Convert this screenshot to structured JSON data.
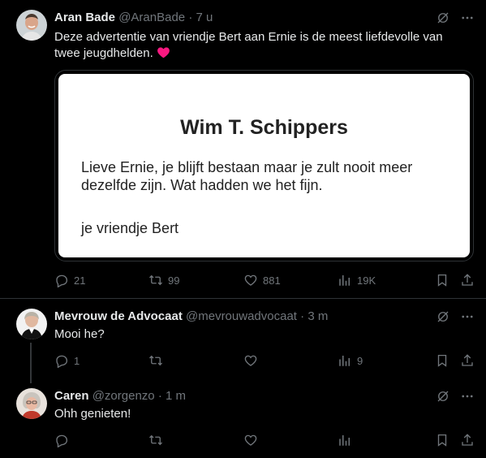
{
  "tweets": [
    {
      "name": "Aran Bade",
      "handle": "@AranBade",
      "dot": "·",
      "time": "7 u",
      "text": "Deze advertentie van vriendje Bert aan Ernie is de meest liefdevolle van twee jeugdhelden.",
      "emoji": "❤️",
      "card": {
        "title": "Wim T. Schippers",
        "message": "Lieve Ernie, je blijft bestaan maar je zult nooit meer dezelfde zijn. Wat hadden we het fijn.",
        "signature": "je vriendje Bert"
      },
      "replies": "21",
      "reposts": "99",
      "likes": "881",
      "views": "19K"
    },
    {
      "name": "Mevrouw de Advocaat",
      "handle": "@mevrouwadvocaat",
      "dot": "·",
      "time": "3 m",
      "text": "Mooi he?",
      "replies": "1",
      "reposts": "",
      "likes": "",
      "views": "9"
    },
    {
      "name": "Caren",
      "handle": "@zorgenzo",
      "dot": "·",
      "time": "1 m",
      "text": "Ohh genieten!",
      "replies": "",
      "reposts": "",
      "likes": "",
      "views": ""
    }
  ],
  "icons": {
    "grok": "grok-icon",
    "more": "more-icon",
    "reply": "reply-icon",
    "repost": "repost-icon",
    "like": "like-icon",
    "views": "views-icon",
    "bookmark": "bookmark-icon",
    "share": "share-icon"
  },
  "colors": {
    "background": "#000000",
    "text": "#e7e9ea",
    "muted": "#71767b",
    "divider": "#2f3336",
    "heart": "#f91880"
  }
}
